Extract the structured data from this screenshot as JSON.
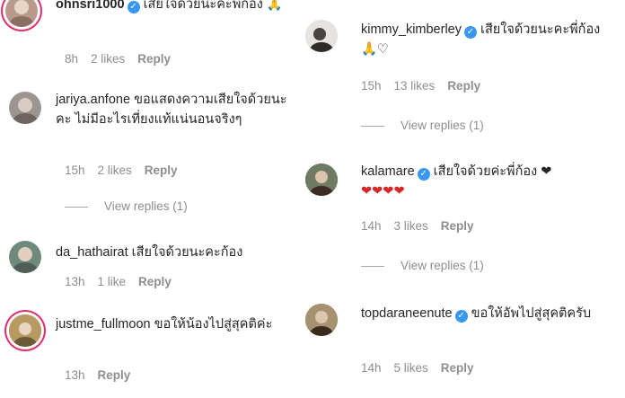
{
  "left": [
    {
      "user": "ohnsri1000",
      "verified": true,
      "text": "เสียใจด้วยนะคะพี่ก้อง 🙏",
      "time": "8h",
      "likes": "2 likes",
      "reply": "Reply",
      "avatar_color": "#b89b8a"
    },
    {
      "user": "jariya.anfone",
      "verified": false,
      "text": "ขอแสดงความเสียใจด้วยนะคะ ไม่มีอะไรเที่ยงแท้แน่นอนจริงๆ",
      "time": "15h",
      "likes": "2 likes",
      "reply": "Reply",
      "view_replies": "View replies (1)",
      "avatar_color": "#9c9490"
    },
    {
      "user": "da_hathairat",
      "verified": false,
      "text": "เสียใจด้วยนะคะก้อง",
      "time": "13h",
      "likes": "1 like",
      "reply": "Reply",
      "avatar_color": "#6d8a7c"
    },
    {
      "user": "justme_fullmoon",
      "verified": false,
      "text": "ขอให้น้องไปสู่สุคติค่ะ",
      "time": "13h",
      "reply": "Reply",
      "avatar_color": "#8f7a52"
    }
  ],
  "right": [
    {
      "user": "kimmy_kimberley",
      "verified": true,
      "text": "เสียใจด้วยนะคะพี่ก้อง 🙏♡",
      "time": "15h",
      "likes": "13 likes",
      "reply": "Reply",
      "view_replies": "View replies (1)",
      "avatar_color": "#d8d4d0"
    },
    {
      "user": "kalamare",
      "verified": true,
      "text": "เสียใจด้วยค่ะพี่ก้อง ❤",
      "hearts": "❤❤❤❤",
      "time": "14h",
      "likes": "3 likes",
      "reply": "Reply",
      "view_replies": "View replies (1)",
      "avatar_color": "#5f6b55"
    },
    {
      "user": "topdaraneenute",
      "verified": true,
      "text": "ขอให้อัพไปสู่สุคติครับ",
      "time": "14h",
      "likes": "5 likes",
      "reply": "Reply",
      "avatar_color": "#7c6a4e"
    }
  ]
}
